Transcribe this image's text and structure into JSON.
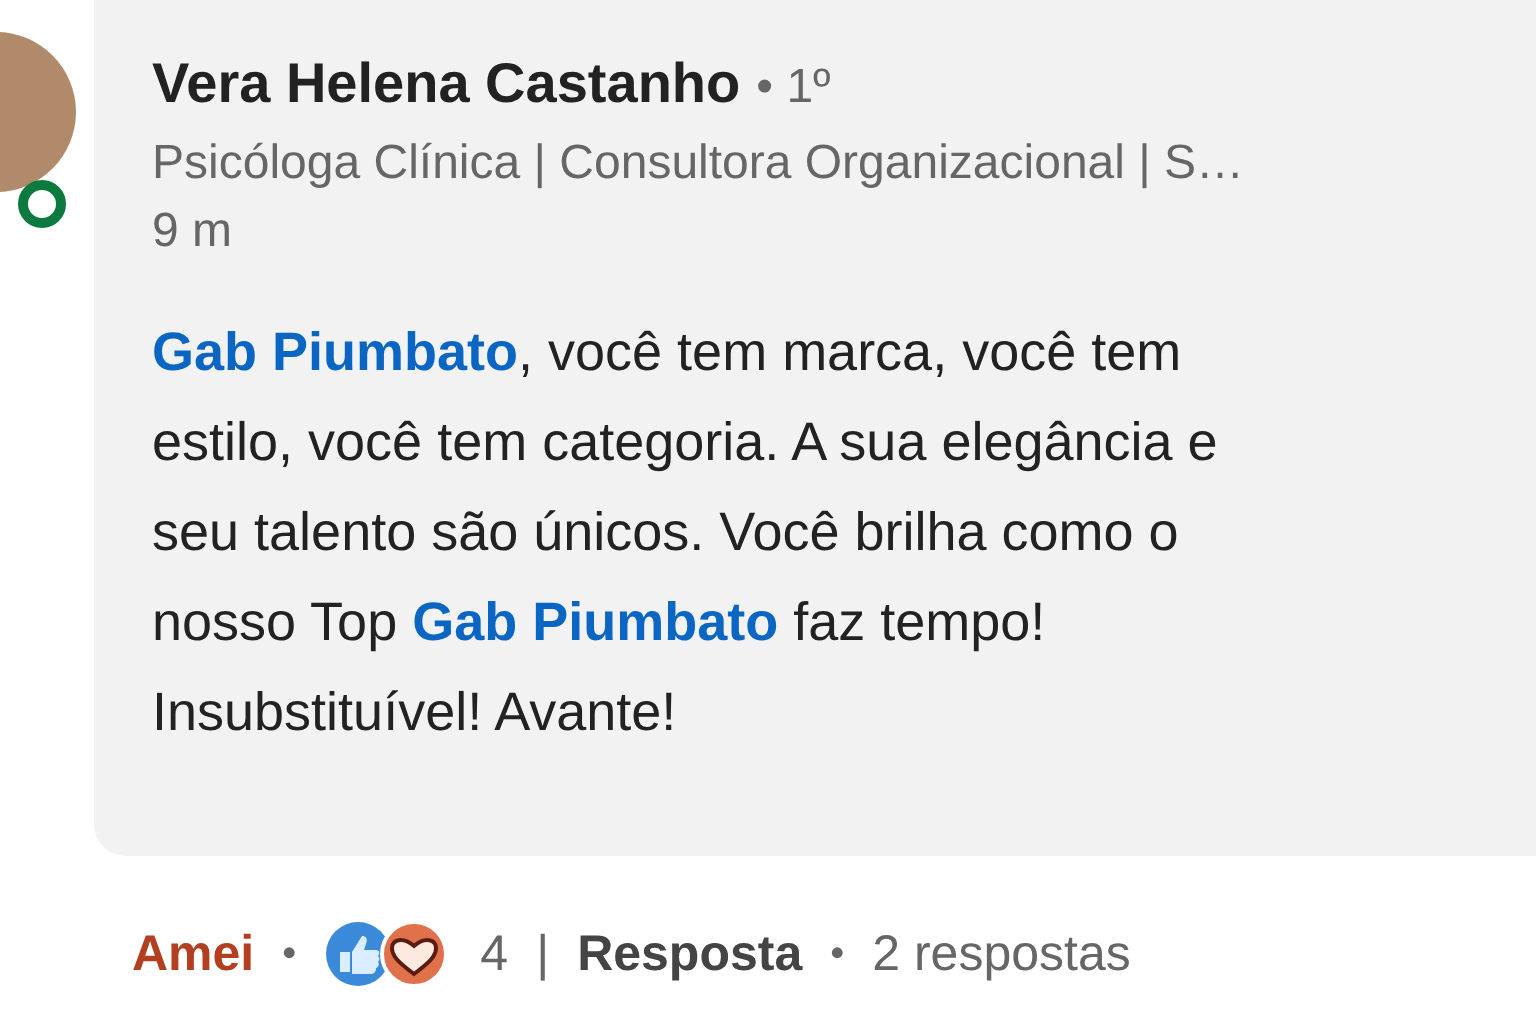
{
  "comment": {
    "author": "Vera Helena Castanho",
    "online": true,
    "degree": "• 1º",
    "headline": "Psicóloga Clínica | Consultora Organizacional | S…",
    "time": "9 m",
    "lines": [
      [
        {
          "kind": "mention",
          "text": "Gab Piumbato"
        },
        {
          "kind": "text",
          "text": ", você tem marca, você tem"
        }
      ],
      [
        {
          "kind": "text",
          "text": "estilo, você tem categoria. A sua elegância e"
        }
      ],
      [
        {
          "kind": "text",
          "text": "seu talento são únicos. Você brilha como o"
        }
      ],
      [
        {
          "kind": "text",
          "text": "nosso Top "
        },
        {
          "kind": "mention",
          "text": "Gab Piumbato"
        },
        {
          "kind": "text",
          "text": " faz tempo!"
        }
      ],
      [
        {
          "kind": "text",
          "text": "Insubstituível! Avante!"
        }
      ]
    ]
  },
  "actions": {
    "reaction": "Amei",
    "reacted": true,
    "separator": "•",
    "reaction_count": "4",
    "divider": "|",
    "reply": "Resposta",
    "separator_2": "•",
    "replies": "2 respostas"
  }
}
